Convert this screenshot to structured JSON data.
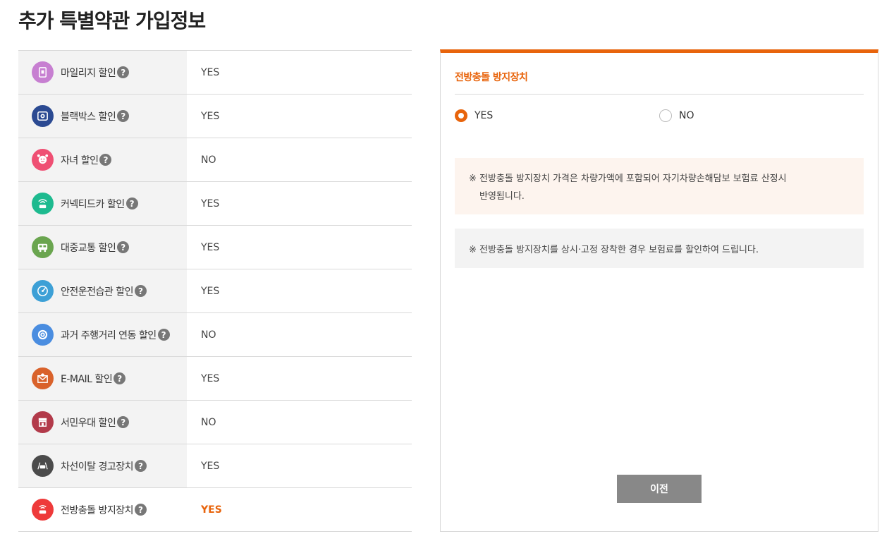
{
  "page": {
    "title": "추가 특별약관 가입정보"
  },
  "colors": {
    "accent": "#e8640c",
    "button": "#888888"
  },
  "rows": [
    {
      "label": "마일리지 할인",
      "value": "YES",
      "icon": "mileage-icon",
      "icon_color": "#c77fd1"
    },
    {
      "label": "블랙박스 할인",
      "value": "YES",
      "icon": "blackbox-icon",
      "icon_color": "#2b4a92"
    },
    {
      "label": "자녀 할인",
      "value": "NO",
      "icon": "child-icon",
      "icon_color": "#ef4f73"
    },
    {
      "label": "커넥티드카 할인",
      "value": "YES",
      "icon": "connected-car-icon",
      "icon_color": "#1dba8f"
    },
    {
      "label": "대중교통 할인",
      "value": "YES",
      "icon": "bus-icon",
      "icon_color": "#6aa54f"
    },
    {
      "label": "안전운전습관 할인",
      "value": "YES",
      "icon": "speedometer-icon",
      "icon_color": "#3da0d6"
    },
    {
      "label": "과거 주행거리 연동 할인",
      "value": "NO",
      "icon": "odometer-icon",
      "icon_color": "#4a8de0"
    },
    {
      "label": "E-MAIL 할인",
      "value": "YES",
      "icon": "email-icon",
      "icon_color": "#d9622b"
    },
    {
      "label": "서민우대 할인",
      "value": "NO",
      "icon": "store-icon",
      "icon_color": "#b23a4a"
    },
    {
      "label": "차선이탈 경고장치",
      "value": "YES",
      "icon": "lane-car-icon",
      "icon_color": "#4b4b4b"
    },
    {
      "label": "전방충돌 방지장치",
      "value": "YES",
      "icon": "collision-car-icon",
      "icon_color": "#ee3a3a"
    }
  ],
  "help_glyph": "?",
  "panel": {
    "title": "전방충돌 방지장치",
    "option_yes": "YES",
    "option_no": "NO",
    "selected": "YES",
    "notice1_line1": "※ 전방충돌 방지장치 가격은 차량가액에 포함되어 자기차량손해담보 보험료 산정시",
    "notice1_line2": "반영됩니다.",
    "notice2": "※ 전방충돌 방지장치를 상시·고정 장착한 경우 보험료를 할인하여 드립니다.",
    "prev_label": "이전"
  }
}
